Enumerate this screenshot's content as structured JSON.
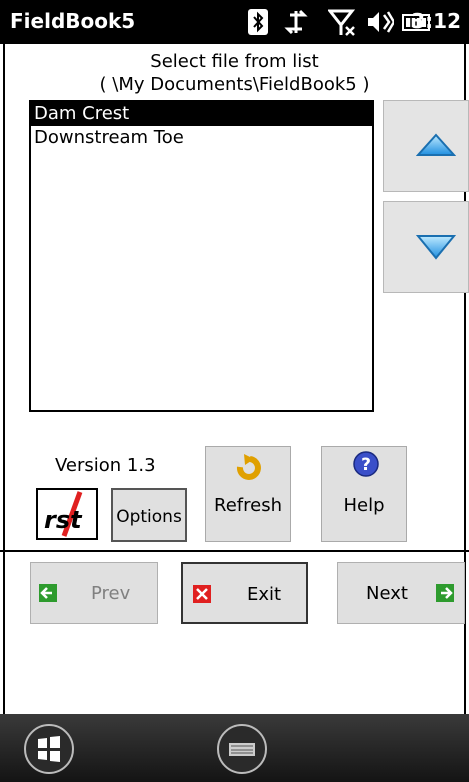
{
  "status_bar": {
    "title": "FieldBook5",
    "time": "3:12",
    "icons": [
      "bluetooth-icon",
      "sync-icon",
      "no-signal-icon",
      "speaker-icon",
      "battery-icon"
    ]
  },
  "prompt": {
    "line1": "Select file from list",
    "line2": "( \\My Documents\\FieldBook5 )"
  },
  "file_list": {
    "items": [
      "Dam Crest",
      "Downstream Toe"
    ],
    "selected": "Dam Crest"
  },
  "scroll": {
    "up_icon": "arrow-up-icon",
    "down_icon": "arrow-down-icon"
  },
  "version": "Version 1.3",
  "logo": {
    "text": "rst"
  },
  "buttons": {
    "options": "Options",
    "refresh": "Refresh",
    "help": "Help"
  },
  "nav": {
    "prev": "Prev",
    "exit": "Exit",
    "next": "Next"
  },
  "colors": {
    "selection": "#000000",
    "nav_green": "#2e9b2e",
    "exit_red": "#e02020",
    "arrow_blue": "#2ea2ea"
  }
}
